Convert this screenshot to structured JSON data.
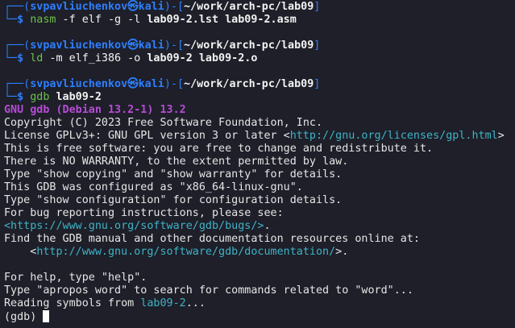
{
  "prompt": {
    "user": "svpavliuchenkov",
    "host_symbol": "㉿",
    "host": "kali",
    "path": "~/work/arch-pc/lab09"
  },
  "commands": [
    {
      "cmd": "nasm",
      "args": " -f elf -g -l ",
      "f1": "lab09-2.lst",
      "f2": "lab09-2.asm"
    },
    {
      "cmd": "ld",
      "args": " -m ",
      "opt": "elf_i386",
      "args2": " -o ",
      "f1": "lab09-2",
      "f2": "lab09-2.o"
    },
    {
      "cmd": "gdb",
      "f1": "lab09-2"
    }
  ],
  "gdb_output": {
    "banner": "GNU gdb (Debian 13.2-1) 13.2",
    "copyright": "Copyright (C) 2023 Free Software Foundation, Inc.",
    "license_pre": "License GPLv3+: GNU GPL version 3 or later <",
    "license_url": "http://gnu.org/licenses/gpl.html",
    "license_post": ">",
    "free": "This is free software: you are free to change and redistribute it.",
    "warranty": "There is NO WARRANTY, to the extent permitted by law.",
    "show_copying": "Type \"show copying\" and \"show warranty\" for details.",
    "configured": "This GDB was configured as \"x86_64-linux-gnu\".",
    "show_config": "Type \"show configuration\" for configuration details.",
    "bug_instr": "For bug reporting instructions, please see:",
    "bug_url": "<https://www.gnu.org/software/gdb/bugs/>",
    "bug_post": ".",
    "manual": "Find the GDB manual and other documentation resources online at:",
    "doc_pre": "    <",
    "doc_url": "http://www.gnu.org/software/gdb/documentation/",
    "doc_post": ">.",
    "help": "For help, type \"help\".",
    "apropos": "Type \"apropos word\" to search for commands related to \"word\"...",
    "reading_pre": "Reading symbols from ",
    "reading_file": "lab09-2",
    "reading_post": "...",
    "gdb_prompt": "(gdb) "
  },
  "colors": {
    "background": "#1e1f29",
    "prompt_blue": "#2d7fff",
    "command_green": "#6cc04a",
    "url_cyan": "#3fb3c6",
    "gdb_purple": "#b74cd5",
    "text": "#e6e6e6"
  }
}
